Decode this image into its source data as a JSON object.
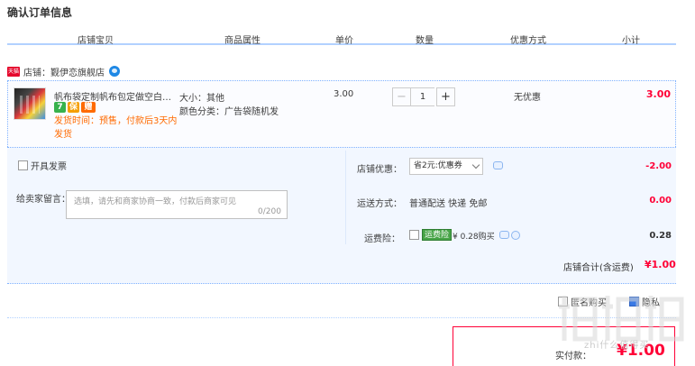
{
  "page_title": "确认订单信息",
  "columns": [
    "店铺宝贝",
    "商品属性",
    "单价",
    "数量",
    "优惠方式",
    "小计"
  ],
  "shop": {
    "badge": "天猫",
    "label": "店铺：觐伊恋旗舰店"
  },
  "item": {
    "title": "帆布袋定制帆布包定做空白diy手提袋",
    "svc_icons": [
      "7",
      "保",
      "赠"
    ],
    "ship_note": "发货时间：预售，付款后3天内发货",
    "attr_size": "大小：其他",
    "attr_color": "颜色分类：广告袋随机发",
    "price": "3.00",
    "quantity": "1",
    "minus_label": "−",
    "plus_label": "+",
    "promo": "无优惠",
    "subtotal": "3.00"
  },
  "options": {
    "invoice_label": "开具发票",
    "message_label": "给卖家留言：",
    "message_placeholder": "选填，请先和商家协商一致，付款后商家可见",
    "message_count": "0/200",
    "shop_promo_label": "店铺优惠：",
    "shop_promo_value": "省2元:优惠券",
    "shop_promo_amount": "-2.00",
    "shipping_label": "运送方式：",
    "shipping_value": "普通配送 快递 免邮",
    "shipping_amount": "0.00",
    "insurance_label": "运费险：",
    "insurance_badge": "运费险",
    "insurance_text": "¥ 0.28购买",
    "insurance_amount": "0.28"
  },
  "shop_total": {
    "label": "店铺合计(含运费)",
    "value": "¥1.00"
  },
  "extras": {
    "anonymous_label": "匿名购买",
    "hidden_label": "隐私",
    "anonymous_checked": false,
    "hidden_checked": true
  },
  "payment": {
    "label": "实付款：",
    "value": "¥1.00"
  },
  "watermark": {
    "text": "zhi什么值得买"
  },
  "colors": {
    "accent_red": "#ff0036",
    "accent_blue": "#b2d1ff",
    "note_orange": "#ff6a00"
  }
}
